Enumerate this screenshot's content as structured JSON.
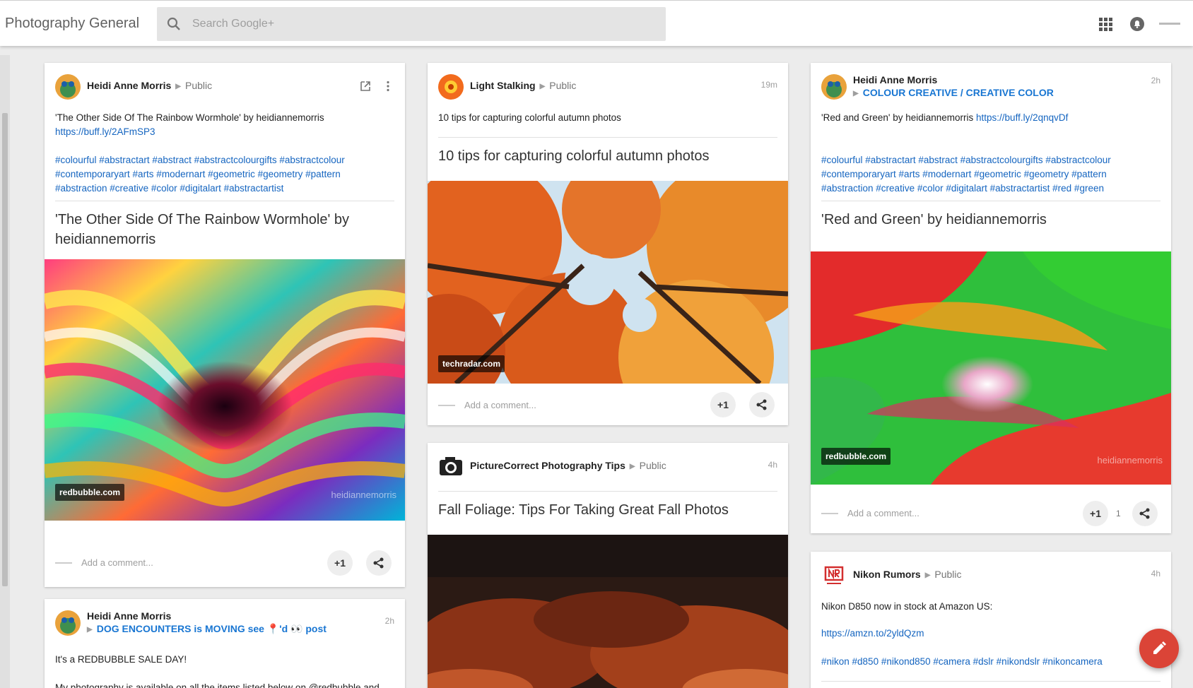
{
  "app": {
    "title": "Photography General",
    "search_placeholder": "Search Google+",
    "icons": [
      "search-icon",
      "apps-icon",
      "notifications-icon",
      "account-icon"
    ]
  },
  "posts": [
    {
      "author": "Heidi Anne Morris",
      "visibility": "Public",
      "text_line1": "'The Other Side Of The Rainbow Wormhole'  by heidiannemorris",
      "text_link": "https://buff.ly/2AFmSP3",
      "hashtags": "#colourful #abstractart #abstract #abstractcolourgifts #abstractcolour #contemporaryart #arts #modernart #geometric #geometry #pattern #abstraction #creative #color #digitalart #abstractartist",
      "link_title": "'The Other Side Of The Rainbow Wormhole' by heidiannemorris",
      "source": "redbubble.com",
      "watermark": "heidiannemorris",
      "comment_placeholder": "Add a comment...",
      "plus_label": "+1"
    },
    {
      "author": "Heidi Anne Morris",
      "time": "2h",
      "community": "DOG ENCOUNTERS is MOVING see 📍'd 👀 post",
      "text_line1": "It's a REDBUBBLE SALE DAY!",
      "text_line2": "My photography is available on all the items listed below on @redbubble and"
    },
    {
      "author": "Light Stalking",
      "visibility": "Public",
      "time": "19m",
      "text_line1": "10 tips for capturing colorful autumn photos",
      "link_title": "10 tips for capturing colorful autumn photos",
      "source": "techradar.com",
      "comment_placeholder": "Add a comment...",
      "plus_label": "+1"
    },
    {
      "author": "PictureCorrect Photography Tips",
      "visibility": "Public",
      "time": "4h",
      "link_title": "Fall Foliage: Tips For Taking Great Fall Photos"
    },
    {
      "author": "Heidi Anne Morris",
      "time": "2h",
      "community": "COLOUR CREATIVE / CREATIVE COLOR",
      "text_line1": "'Red and Green'  by heidiannemorris ",
      "text_link": "https://buff.ly/2qnqvDf",
      "hashtags": "#colourful #abstractart #abstract #abstractcolourgifts #abstractcolour #contemporaryart #arts #modernart #geometric #geometry #pattern #abstraction #creative #color #digitalart #abstractartist #red #green",
      "link_title": "'Red and Green' by heidiannemorris",
      "source": "redbubble.com",
      "watermark": "heidiannemorris",
      "comment_placeholder": "Add a comment...",
      "plus_label": "+1",
      "plus_count": "1"
    },
    {
      "author": "Nikon Rumors",
      "visibility": "Public",
      "time": "4h",
      "text_line1": "Nikon D850 now in stock at Amazon US:",
      "text_link": "https://amzn.to/2yldQzm",
      "hashtags": "#nikon #d850 #nikond850 #camera #dslr #nikondslr #nikoncamera"
    }
  ],
  "colors": {
    "accent_link": "#1565c0",
    "community_link": "#1976d2",
    "fab": "#db4437",
    "background": "#ececec"
  }
}
